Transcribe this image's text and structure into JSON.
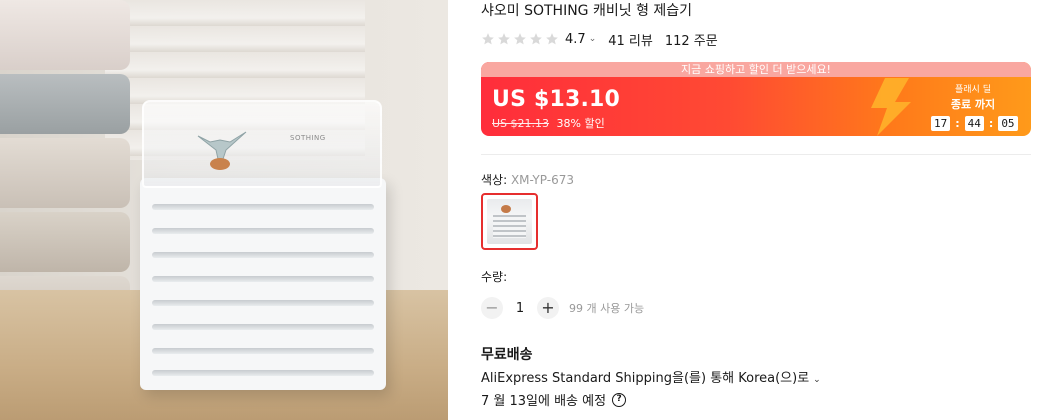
{
  "product": {
    "title": "샤오미 SOTHING 캐비닛 형 제습기",
    "image_logo": "SOTHING"
  },
  "rating": {
    "stars_filled": 0,
    "stars_total": 5,
    "score": "4.7",
    "reviews": "41 리뷰",
    "orders": "112 주문"
  },
  "deal": {
    "banner": "지금 쇼핑하고 할인 더 받으세요!",
    "price": "US $13.10",
    "old_price": "US $21.13",
    "discount": "38% 할인",
    "flash_label": "플래시 딜",
    "flash_sub": "종료 까지",
    "timer": {
      "h": "17",
      "m": "44",
      "s": "05"
    },
    "colors": {
      "start": "#ff2d3b",
      "end": "#ff9a1a"
    }
  },
  "variant": {
    "label": "색상:",
    "value": "XM-YP-673"
  },
  "quantity": {
    "label": "수량:",
    "minus": "−",
    "value": "1",
    "plus": "+",
    "available": "99 개 사용 가능"
  },
  "shipping": {
    "title": "무료배송",
    "via": "AliExpress Standard Shipping을(를) 통해 Korea(으)로",
    "date": "7 월 13일에 배송 예정",
    "help": "?"
  }
}
